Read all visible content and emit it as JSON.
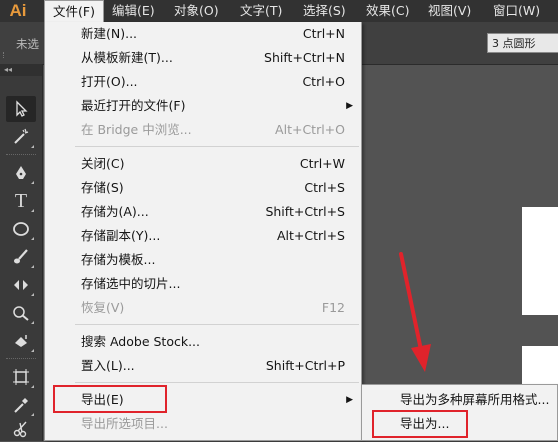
{
  "app": {
    "logo": "Ai"
  },
  "menubar": {
    "items": [
      {
        "label": "文件(F)",
        "active": true
      },
      {
        "label": "编辑(E)"
      },
      {
        "label": "对象(O)"
      },
      {
        "label": "文字(T)"
      },
      {
        "label": "选择(S)"
      },
      {
        "label": "效果(C)"
      },
      {
        "label": "视图(V)"
      },
      {
        "label": "窗口(W)"
      }
    ]
  },
  "controlbar": {
    "selection_label": "未选",
    "stroke_profile": "3 点圆形"
  },
  "toolbar": {
    "collapse": "◂◂"
  },
  "file_menu": {
    "items": [
      {
        "label": "新建(N)...",
        "shortcut": "Ctrl+N"
      },
      {
        "label": "从模板新建(T)...",
        "shortcut": "Shift+Ctrl+N"
      },
      {
        "label": "打开(O)...",
        "shortcut": "Ctrl+O"
      },
      {
        "label": "最近打开的文件(F)",
        "shortcut": "",
        "submenu": true
      },
      {
        "label": "在 Bridge 中浏览...",
        "shortcut": "Alt+Ctrl+O",
        "disabled": true
      },
      {
        "label": "关闭(C)",
        "shortcut": "Ctrl+W"
      },
      {
        "label": "存储(S)",
        "shortcut": "Ctrl+S"
      },
      {
        "label": "存储为(A)...",
        "shortcut": "Shift+Ctrl+S"
      },
      {
        "label": "存储副本(Y)...",
        "shortcut": "Alt+Ctrl+S"
      },
      {
        "label": "存储为模板...",
        "shortcut": ""
      },
      {
        "label": "存储选中的切片...",
        "shortcut": ""
      },
      {
        "label": "恢复(V)",
        "shortcut": "F12",
        "disabled": true
      },
      {
        "label": "搜索 Adobe Stock...",
        "shortcut": ""
      },
      {
        "label": "置入(L)...",
        "shortcut": "Shift+Ctrl+P"
      },
      {
        "label": "导出(E)",
        "shortcut": "",
        "submenu": true
      },
      {
        "label": "导出所选项目...",
        "shortcut": "",
        "disabled": true
      }
    ]
  },
  "export_submenu": {
    "items": [
      {
        "label": "导出为多种屏幕所用格式..."
      },
      {
        "label": "导出为..."
      }
    ]
  },
  "colors": {
    "highlight": "#e0232b",
    "menu_bg": "#f2f2f2",
    "chrome": "#323232"
  }
}
